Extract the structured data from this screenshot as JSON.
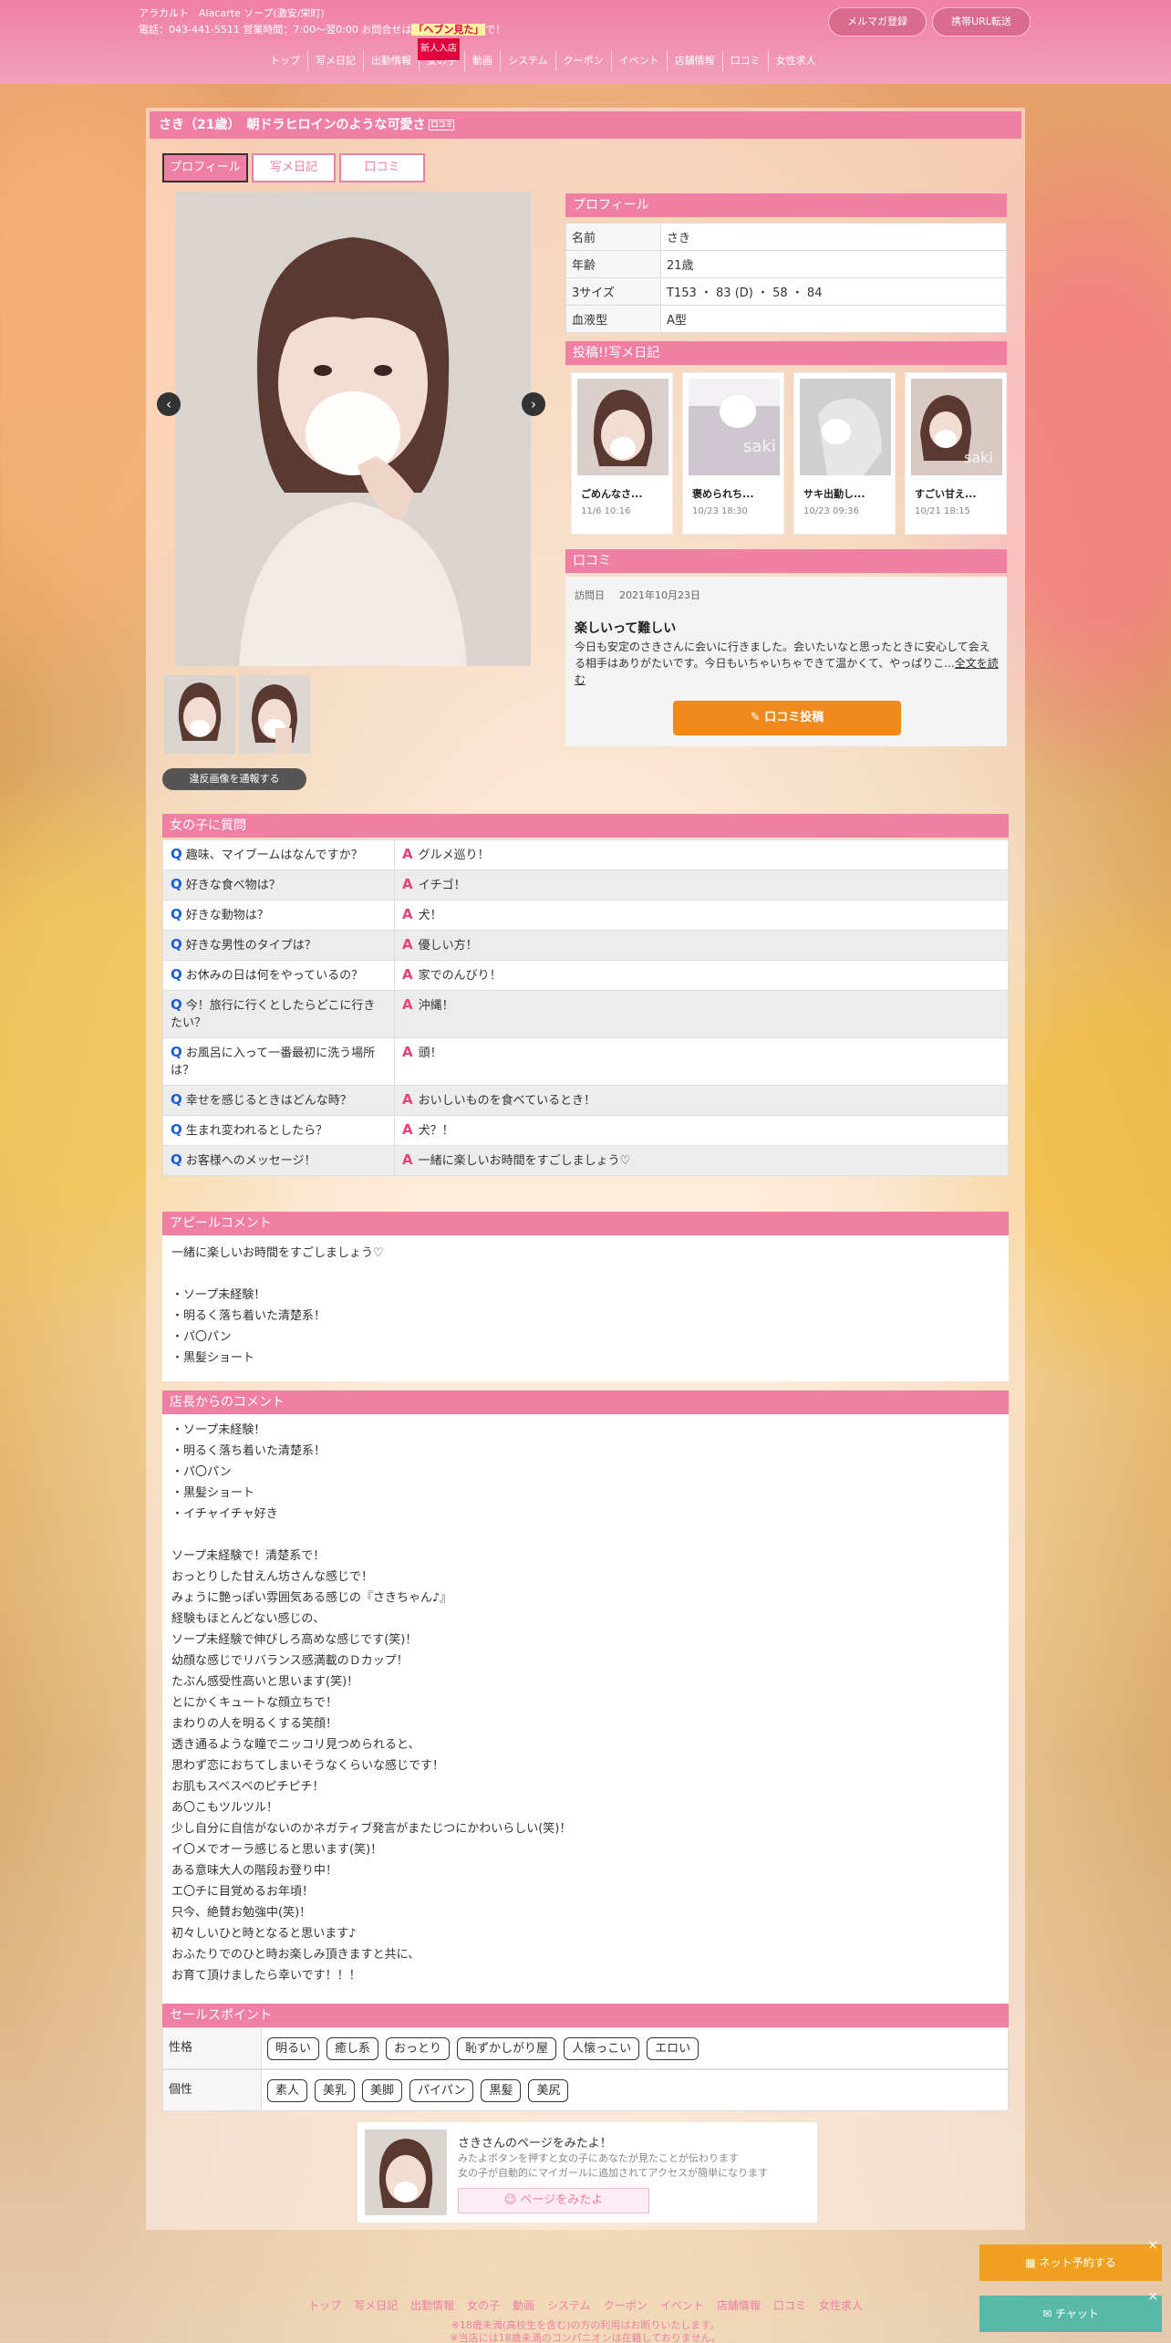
{
  "header": {
    "shop_name": "アラカルト　Alacarte ソープ(激安/栄町)",
    "phone_text": "電話：043-441-5511 営業時間：7:00～翌0:00 お問合せは",
    "phone_highlight": "「ヘブン見た」",
    "phone_suffix": "で！",
    "mail_btn": "メルマガ登録",
    "mobile_btn": "携帯URL転送",
    "nav": [
      "トップ",
      "写メ日記",
      "出勤情報",
      "女の子",
      "動画",
      "システム",
      "クーポン",
      "イベント",
      "店舗情報",
      "口コミ",
      "女性求人"
    ],
    "new_badge": "新人入店"
  },
  "profile": {
    "title": "さき（21歳）　朝ドラヒロインのような可愛さ",
    "title_icon": "口コミ",
    "tabs": [
      "プロフィール",
      "写メ日記",
      "口コミ"
    ],
    "report_btn": "違反画像を通報する",
    "section_title": "プロフィール",
    "rows": [
      {
        "key": "名前",
        "value": "さき"
      },
      {
        "key": "年齢",
        "value": "21歳"
      },
      {
        "key": "3サイズ",
        "value": "T153 ・ 83 (D) ・ 58 ・ 84"
      },
      {
        "key": "血液型",
        "value": "A型"
      }
    ]
  },
  "diary": {
    "title": "投稿!!写メ日記",
    "items": [
      {
        "title": "ごめんなさ...",
        "date": "11/6 10:16"
      },
      {
        "title": "褒められち...",
        "date": "10/23 18:30"
      },
      {
        "title": "サキ出勤し...",
        "date": "10/23 09:36"
      },
      {
        "title": "すごい甘え...",
        "date": "10/21 18:15"
      }
    ]
  },
  "review": {
    "title": "口コミ",
    "visit_label": "訪問日",
    "visit_date": "2021年10月23日",
    "heading": "楽しいって難しい",
    "body": "今日も安定のさきさんに会いに行きました。会いたいなと思ったときに安心して会える相手はありがたいです。今日もいちゃいちゃできて温かくて、やっぱりこ...",
    "more": "全文を読む",
    "post_btn": "口コミ投稿"
  },
  "qa": {
    "title": "女の子に質問",
    "q_mark": "Q",
    "a_mark": "A",
    "items": [
      {
        "q": "趣味、マイブームはなんですか？",
        "a": "グルメ巡り！"
      },
      {
        "q": "好きな食べ物は？",
        "a": "イチゴ！"
      },
      {
        "q": "好きな動物は？",
        "a": "犬！"
      },
      {
        "q": "好きな男性のタイプは？",
        "a": "優しい方！"
      },
      {
        "q": "お休みの日は何をやっているの？",
        "a": "家でのんびり！"
      },
      {
        "q": "今！旅行に行くとしたらどこに行きたい？",
        "a": "沖縄！"
      },
      {
        "q": "お風呂に入って一番最初に洗う場所は？",
        "a": "頭！"
      },
      {
        "q": "幸せを感じるときはどんな時？",
        "a": "おいしいものを食べているとき！"
      },
      {
        "q": "生まれ変われるとしたら？",
        "a": "犬？！"
      },
      {
        "q": "お客様へのメッセージ！",
        "a": "一緒に楽しいお時間をすごしましょう♡"
      }
    ]
  },
  "appeal": {
    "title": "アピールコメント",
    "lines": [
      "一緒に楽しいお時間をすごしましょう♡",
      "",
      "・ソープ未経験！",
      "・明るく落ち着いた清楚系！",
      "・パ〇パン",
      "・黒髪ショート"
    ]
  },
  "manager": {
    "title": "店長からのコメント",
    "lines": [
      "・ソープ未経験！",
      "・明るく落ち着いた清楚系！",
      "・パ〇パン",
      "・黒髪ショート",
      "・イチャイチャ好き",
      "",
      "ソープ未経験で！清楚系で！",
      "おっとりした甘えん坊さんな感じで！",
      "みょうに艶っぽい雰囲気ある感じの『さきちゃん♪』",
      "経験もほとんどない感じの、",
      "ソープ未経験で伸びしろ高めな感じです(笑)！",
      "幼顔な感じでリバランス感満載のＤカップ！",
      "たぶん感受性高いと思います(笑)！",
      "とにかくキュートな顔立ちで！",
      "まわりの人を明るくする笑顔！",
      "透き通るような瞳でニッコリ見つめられると、",
      "思わず恋におちてしまいそうなくらいな感じです！",
      "お肌もスベスベのピチピチ！",
      "あ〇こもツルツル！",
      "少し自分に自信がないのかネガティブ発言がまたじつにかわいらしい(笑)！",
      "イ〇メでオーラ感じると思います(笑)！",
      "ある意味大人の階段お登り中！",
      "エ〇チに目覚めるお年頃！",
      "只今、絶賛お勉強中(笑)！",
      "初々しいひと時となると思います♪",
      "おふたりでのひと時お楽しみ頂きますと共に、",
      "お育て頂けましたら幸いです！！！"
    ]
  },
  "sales": {
    "title": "セールスポイント",
    "rows": [
      {
        "label": "性格",
        "tags": [
          "明るい",
          "癒し系",
          "おっとり",
          "恥ずかしがり屋",
          "人懐っこい",
          "エロい"
        ]
      },
      {
        "label": "個性",
        "tags": [
          "素人",
          "美乳",
          "美脚",
          "パイパン",
          "黒髪",
          "美尻"
        ]
      }
    ]
  },
  "share": {
    "title": "さきさんのページをみたよ！",
    "desc1": "みたよボタンを押すと女の子にあなたが見たことが伝わります",
    "desc2": "女の子が自動的にマイガールに追加されてアクセスが簡単になります",
    "btn": "ページをみたよ"
  },
  "footer": {
    "nav": [
      "トップ",
      "写メ日記",
      "出勤情報",
      "女の子",
      "動画",
      "システム",
      "クーポン",
      "イベント",
      "店舗情報",
      "口コミ",
      "女性求人"
    ],
    "note1": "※18歳未満(高校生を含む)の方の利用はお断りいたします。",
    "note2": "※当店には18歳未満のコンパニオンは在籍しておりません。"
  },
  "floating": {
    "reserve": "ネット予約する",
    "chat": "チャット"
  },
  "colors": {
    "brand_pink": "#f07fa4",
    "accent_orange": "#f08a1c",
    "chat_teal": "#5ab8a8"
  }
}
